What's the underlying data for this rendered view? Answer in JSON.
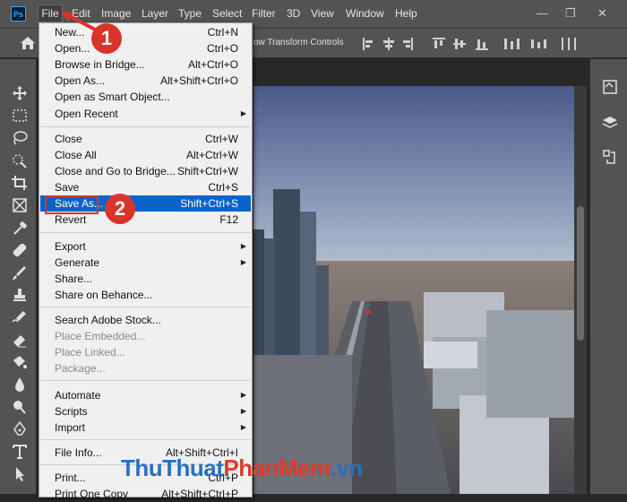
{
  "app": {
    "logo": "Ps"
  },
  "menubar": [
    "File",
    "Edit",
    "Image",
    "Layer",
    "Type",
    "Select",
    "Filter",
    "3D",
    "View",
    "Window",
    "Help"
  ],
  "window_controls": {
    "minimize": "—",
    "restore": "❐",
    "close": "✕"
  },
  "options_bar": {
    "transform_controls_label": "ow Transform Controls"
  },
  "file_menu": {
    "items": [
      {
        "label": "New...",
        "shortcut": "Ctrl+N"
      },
      {
        "label": "Open...",
        "shortcut": "Ctrl+O"
      },
      {
        "label": "Browse in Bridge...",
        "shortcut": "Alt+Ctrl+O"
      },
      {
        "label": "Open As...",
        "shortcut": "Alt+Shift+Ctrl+O"
      },
      {
        "label": "Open as Smart Object...",
        "shortcut": ""
      },
      {
        "label": "Open Recent",
        "shortcut": ""
      },
      {
        "label": "Close",
        "shortcut": "Ctrl+W"
      },
      {
        "label": "Close All",
        "shortcut": "Alt+Ctrl+W"
      },
      {
        "label": "Close and Go to Bridge...",
        "shortcut": "Shift+Ctrl+W"
      },
      {
        "label": "Save",
        "shortcut": "Ctrl+S"
      },
      {
        "label": "Save As...",
        "shortcut": "Shift+Ctrl+S"
      },
      {
        "label": "Revert",
        "shortcut": "F12"
      },
      {
        "label": "Export",
        "shortcut": ""
      },
      {
        "label": "Generate",
        "shortcut": ""
      },
      {
        "label": "Share...",
        "shortcut": ""
      },
      {
        "label": "Share on Behance...",
        "shortcut": ""
      },
      {
        "label": "Search Adobe Stock...",
        "shortcut": ""
      },
      {
        "label": "Place Embedded...",
        "shortcut": ""
      },
      {
        "label": "Place Linked...",
        "shortcut": ""
      },
      {
        "label": "Package...",
        "shortcut": ""
      },
      {
        "label": "Automate",
        "shortcut": ""
      },
      {
        "label": "Scripts",
        "shortcut": ""
      },
      {
        "label": "Import",
        "shortcut": ""
      },
      {
        "label": "File Info...",
        "shortcut": "Alt+Shift+Ctrl+I"
      },
      {
        "label": "Print...",
        "shortcut": "Ctrl+P"
      },
      {
        "label": "Print One Copy",
        "shortcut": "Alt+Shift+Ctrl+P"
      }
    ]
  },
  "annotations": {
    "step1": "1",
    "step2": "2",
    "accent": "#d9342b"
  },
  "watermark": {
    "part1": "ThuThuat",
    "part2": "PhanMem",
    "part3": ".vn"
  }
}
